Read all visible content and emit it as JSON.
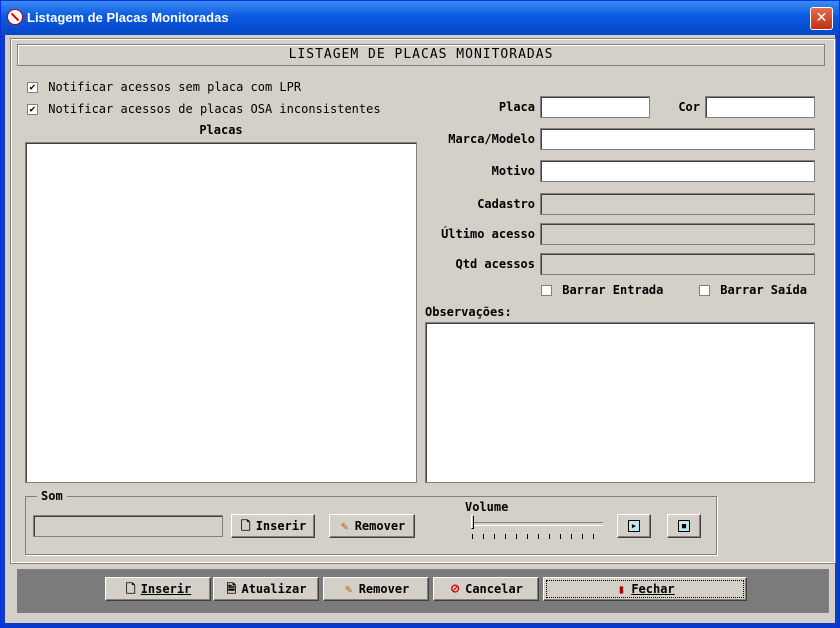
{
  "window": {
    "title": "Listagem de Placas Monitoradas",
    "close_glyph": "✕"
  },
  "header": {
    "title": "LISTAGEM DE PLACAS MONITORADAS"
  },
  "options": {
    "lpr_label": "Notificar acessos sem placa com LPR",
    "lpr_checked": true,
    "osa_label": "Notificar acessos de placas OSA inconsistentes",
    "osa_checked": true
  },
  "list": {
    "heading": "Placas",
    "items": []
  },
  "form": {
    "placa_label": "Placa",
    "placa_value": "",
    "cor_label": "Cor",
    "cor_value": "",
    "marca_label": "Marca/Modelo",
    "marca_value": "",
    "motivo_label": "Motivo",
    "motivo_value": "",
    "cadastro_label": "Cadastro",
    "cadastro_value": "",
    "ultimo_label": "Último acesso",
    "ultimo_value": "",
    "qtd_label": "Qtd acessos",
    "qtd_value": "",
    "barrar_entrada_label": "Barrar Entrada",
    "barrar_saida_label": "Barrar Saída",
    "obs_label": "Observações:",
    "obs_value": ""
  },
  "sound": {
    "group_label": "Som",
    "file_value": "",
    "insert_label": "Inserir",
    "remove_label": "Remover",
    "volume_label": "Volume",
    "volume_level": 0,
    "play_glyph": "▶",
    "stop_glyph": "■"
  },
  "footer": {
    "inserir_label": "Inserir",
    "atualizar_label": "Atualizar",
    "remover_label": "Remover",
    "cancelar_label": "Cancelar",
    "fechar_label": "Fechar"
  },
  "icons": {
    "doc": "🗋",
    "refresh": "🗎",
    "eraser": "✎",
    "cancel": "⊘",
    "door": "▮",
    "check": "✔"
  }
}
